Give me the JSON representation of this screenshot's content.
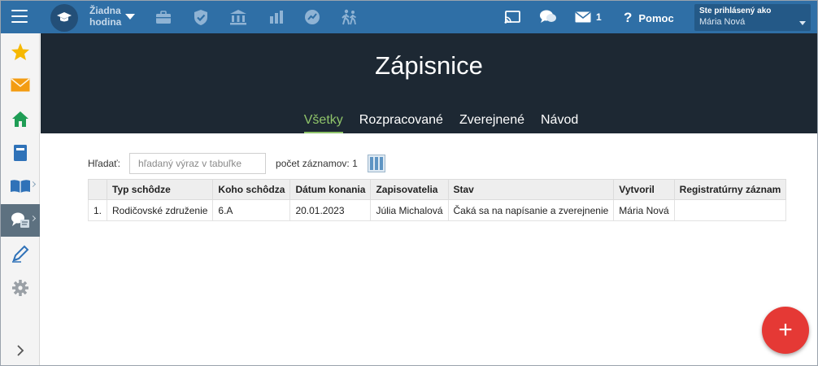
{
  "topbar": {
    "lesson": {
      "line1": "Žiadna",
      "line2": "hodina"
    },
    "messages_count": "1",
    "help_label": "Pomoc",
    "user": {
      "logged_in_label": "Ste prihlásený ako",
      "name": "Mária Nová"
    },
    "icons": [
      "menu-icon",
      "graduation-cap-icon",
      "briefcase-icon",
      "shield-icon",
      "bank-icon",
      "bar-chart-icon",
      "chart-badge-icon",
      "walking-people-icon",
      "cast-icon",
      "chat-icon",
      "envelope-icon"
    ]
  },
  "sidebar": {
    "items": [
      "star-icon",
      "envelope-icon",
      "home-icon",
      "notebook-icon",
      "open-book-icon",
      "meeting-minutes-icon",
      "pen-icon",
      "gear-icon",
      "chevron-right-icon"
    ],
    "active_index": 5
  },
  "page": {
    "title": "Zápisnice",
    "tabs": [
      {
        "label": "Všetky",
        "active": true
      },
      {
        "label": "Rozpracované",
        "active": false
      },
      {
        "label": "Zverejnené",
        "active": false
      },
      {
        "label": "Návod",
        "active": false
      }
    ]
  },
  "toolbar": {
    "search_label": "Hľadať:",
    "search_placeholder": "hľadaný výraz v tabuľke",
    "count_label": "počet záznamov: 1"
  },
  "table": {
    "columns": [
      "",
      "Typ schôdze",
      "Koho schôdza",
      "Dátum konania",
      "Zapisovatelia",
      "Stav",
      "Vytvoril",
      "Registratúrny záznam"
    ],
    "rows": [
      [
        "1.",
        "Rodičovské združenie",
        "6.A",
        "20.01.2023",
        "Júlia Michalová",
        "Čaká sa na napísanie a zverejnenie",
        "Mária Nová",
        ""
      ]
    ]
  },
  "fab": {
    "label": "+"
  },
  "colors": {
    "topbar": "#2f6fa6",
    "header": "#1d2833",
    "active_tab": "#8fc46a",
    "fab": "#e53935",
    "sidebar_active": "#5d7180"
  }
}
